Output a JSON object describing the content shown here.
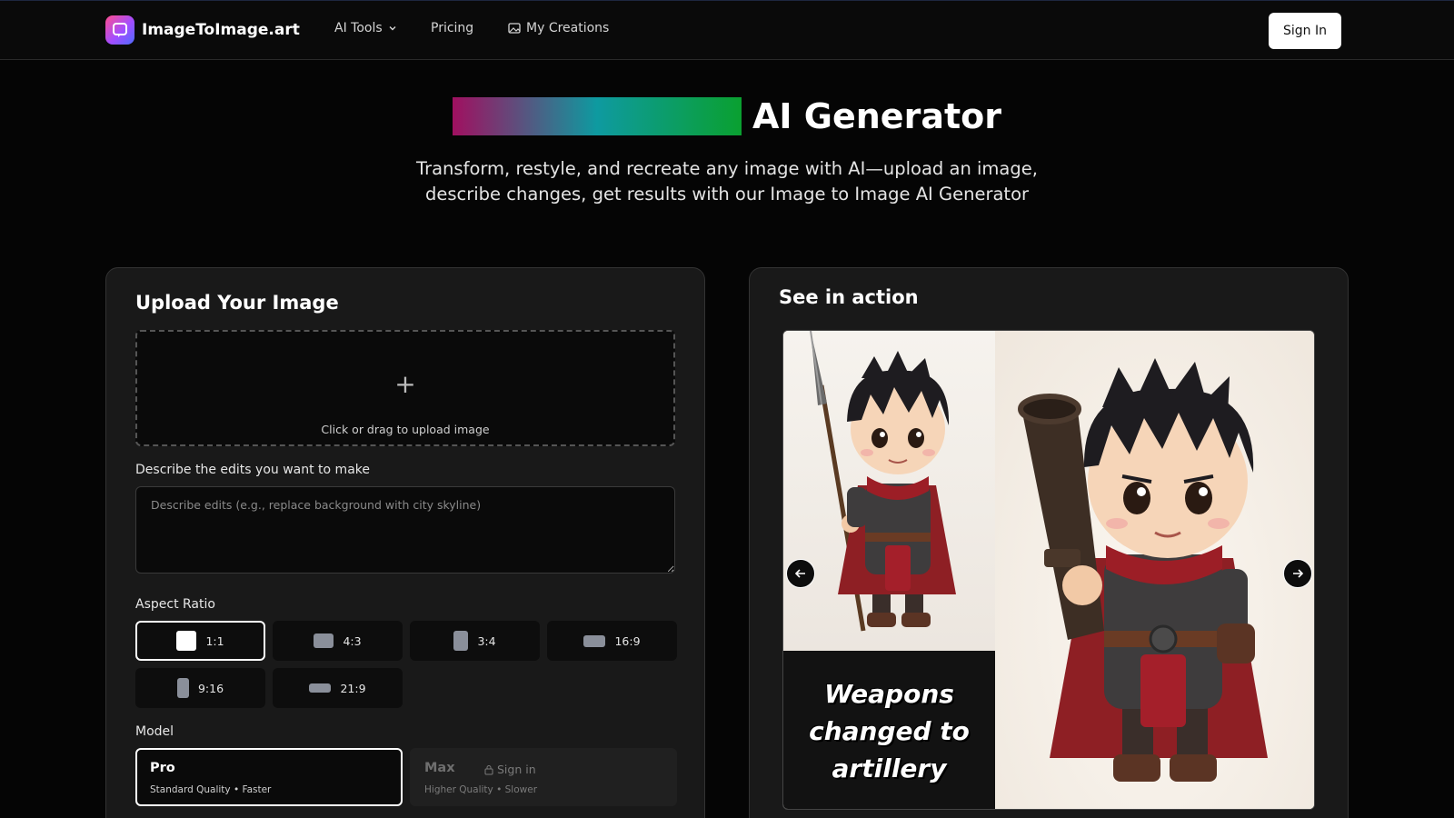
{
  "nav": {
    "brand": "ImageToImage.art",
    "ai_tools": "AI Tools",
    "pricing": "Pricing",
    "my_creations": "My Creations",
    "sign_in": "Sign In"
  },
  "hero": {
    "title": "AI Generator",
    "subtitle_line1": "Transform, restyle, and recreate any image with AI—upload an image,",
    "subtitle_line2": "describe changes, get results with our Image to Image AI Generator"
  },
  "upload": {
    "title": "Upload Your Image",
    "dropzone_text": "Click or drag to upload image",
    "describe_label": "Describe the edits you want to make",
    "describe_placeholder": "Describe edits (e.g., replace background with city skyline)",
    "describe_value": "",
    "aspect_label": "Aspect Ratio",
    "aspect_ratios": [
      {
        "label": "1:1",
        "selected": true
      },
      {
        "label": "4:3",
        "selected": false
      },
      {
        "label": "3:4",
        "selected": false
      },
      {
        "label": "16:9",
        "selected": false
      },
      {
        "label": "9:16",
        "selected": false
      },
      {
        "label": "21:9",
        "selected": false
      }
    ],
    "model_label": "Model",
    "models": [
      {
        "name": "Pro",
        "desc": "Standard Quality • Faster",
        "selected": true
      },
      {
        "name": "Max",
        "desc": "Higher Quality • Slower",
        "lock_text": "Sign in",
        "selected": false
      }
    ]
  },
  "showcase": {
    "title": "See in action",
    "caption_line1": "Weapons",
    "caption_line2": "changed to",
    "caption_line3": "artillery"
  },
  "icons": [
    "logo-icon",
    "chevron-down-icon",
    "image-icon",
    "plus-icon",
    "lock-icon",
    "arrow-left-icon",
    "arrow-right-icon"
  ],
  "colors": {
    "background": "#050505",
    "card": "#191919",
    "accent_start": "#a01060",
    "accent_mid": "#0e9aa0",
    "accent_end": "#0aa030"
  }
}
